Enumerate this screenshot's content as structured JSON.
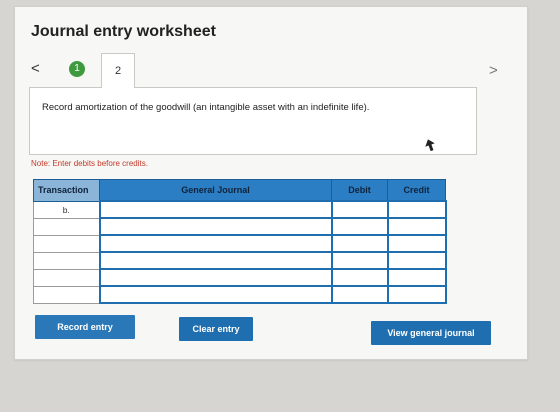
{
  "title": "Journal entry worksheet",
  "nav": {
    "prev": "<",
    "next": ">",
    "step1": "1",
    "step2": "2"
  },
  "instruction": "Record amortization of the goodwill (an intangible asset with an indefinite life).",
  "note": "Note: Enter debits before credits.",
  "table": {
    "headers": {
      "transaction": "Transaction",
      "general_journal": "General Journal",
      "debit": "Debit",
      "credit": "Credit"
    },
    "rows": [
      {
        "transaction": "b."
      },
      {
        "transaction": ""
      },
      {
        "transaction": ""
      },
      {
        "transaction": ""
      },
      {
        "transaction": ""
      },
      {
        "transaction": ""
      }
    ]
  },
  "buttons": {
    "record": "Record entry",
    "clear": "Clear entry",
    "view": "View general journal"
  },
  "colors": {
    "accent": "#1f6fb0",
    "step_complete": "#3f9a3f",
    "note_red": "#c0392b"
  }
}
